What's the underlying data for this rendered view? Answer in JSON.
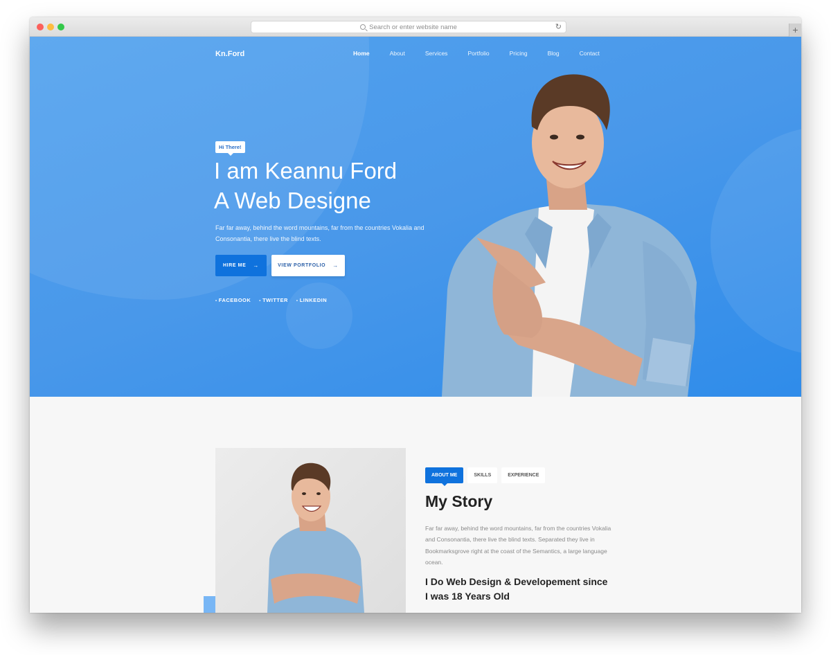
{
  "browser": {
    "address_placeholder": "Search or enter website name",
    "reload_icon": "reload-icon",
    "new_tab_icon": "plus-icon",
    "new_tab_glyph": "+"
  },
  "site": {
    "brand": "Kn.Ford",
    "nav": [
      {
        "label": "Home",
        "active": true
      },
      {
        "label": "About"
      },
      {
        "label": "Services"
      },
      {
        "label": "Portfolio"
      },
      {
        "label": "Pricing"
      },
      {
        "label": "Blog"
      },
      {
        "label": "Contact"
      }
    ]
  },
  "hero": {
    "badge": "Hi There!",
    "title_line1": "I am Keannu Ford",
    "title_line2": "A Web Designe",
    "description": "Far far away, behind the word mountains, far from the countries Vokalia and Consonantia, there live the blind texts.",
    "hire_button": "HIRE ME",
    "portfolio_button": "VIEW PORTFOLIO",
    "arrow_glyph": "→",
    "social": [
      "FACEBOOK",
      "TWITTER",
      "LINKEDIN"
    ],
    "colors": {
      "primary": "#0f72dd",
      "background": "#4998ea"
    }
  },
  "about": {
    "tabs": [
      {
        "label": "ABOUT ME",
        "active": true
      },
      {
        "label": "SKILLS"
      },
      {
        "label": "EXPERIENCE"
      }
    ],
    "title": "My Story",
    "description": "Far far away, behind the word mountains, far from the countries Vokalia and Consonantia, there live the blind texts. Separated they live in Bookmarksgrove right at the coast of the Semantics, a large language ocean.",
    "subtitle": "I Do Web Design & Developement since I was 18 Years Old"
  }
}
